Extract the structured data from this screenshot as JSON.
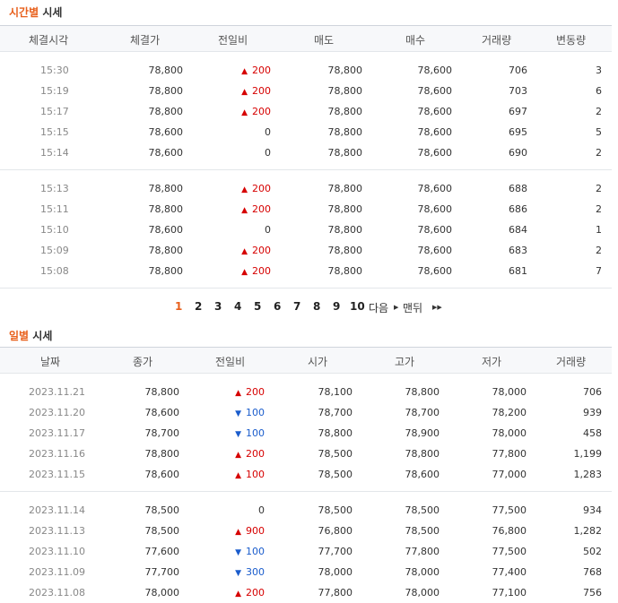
{
  "time_section": {
    "title_highlight": "시간별",
    "title_rest": "시세",
    "headers": [
      "체결시각",
      "체결가",
      "전일비",
      "매도",
      "매수",
      "거래량",
      "변동량"
    ],
    "groups": [
      [
        {
          "time": "15:30",
          "price": "78,800",
          "diff": "200",
          "dir": "up",
          "ask": "78,800",
          "bid": "78,600",
          "volume": "706",
          "change": "3"
        },
        {
          "time": "15:19",
          "price": "78,800",
          "diff": "200",
          "dir": "up",
          "ask": "78,800",
          "bid": "78,600",
          "volume": "703",
          "change": "6"
        },
        {
          "time": "15:17",
          "price": "78,800",
          "diff": "200",
          "dir": "up",
          "ask": "78,800",
          "bid": "78,600",
          "volume": "697",
          "change": "2"
        },
        {
          "time": "15:15",
          "price": "78,600",
          "diff": "0",
          "dir": "none",
          "ask": "78,800",
          "bid": "78,600",
          "volume": "695",
          "change": "5"
        },
        {
          "time": "15:14",
          "price": "78,600",
          "diff": "0",
          "dir": "none",
          "ask": "78,800",
          "bid": "78,600",
          "volume": "690",
          "change": "2"
        }
      ],
      [
        {
          "time": "15:13",
          "price": "78,800",
          "diff": "200",
          "dir": "up",
          "ask": "78,800",
          "bid": "78,600",
          "volume": "688",
          "change": "2"
        },
        {
          "time": "15:11",
          "price": "78,800",
          "diff": "200",
          "dir": "up",
          "ask": "78,800",
          "bid": "78,600",
          "volume": "686",
          "change": "2"
        },
        {
          "time": "15:10",
          "price": "78,600",
          "diff": "0",
          "dir": "none",
          "ask": "78,800",
          "bid": "78,600",
          "volume": "684",
          "change": "1"
        },
        {
          "time": "15:09",
          "price": "78,800",
          "diff": "200",
          "dir": "up",
          "ask": "78,800",
          "bid": "78,600",
          "volume": "683",
          "change": "2"
        },
        {
          "time": "15:08",
          "price": "78,800",
          "diff": "200",
          "dir": "up",
          "ask": "78,800",
          "bid": "78,600",
          "volume": "681",
          "change": "7"
        }
      ]
    ]
  },
  "pagination": {
    "pages": [
      "1",
      "2",
      "3",
      "4",
      "5",
      "6",
      "7",
      "8",
      "9",
      "10"
    ],
    "current": "1",
    "next_label": "다음",
    "last_label": "맨뒤"
  },
  "daily_section": {
    "title_highlight": "일별",
    "title_rest": "시세",
    "headers": [
      "날짜",
      "종가",
      "전일비",
      "시가",
      "고가",
      "저가",
      "거래량"
    ],
    "groups": [
      [
        {
          "date": "2023.11.21",
          "close": "78,800",
          "diff": "200",
          "dir": "up",
          "open": "78,100",
          "high": "78,800",
          "low": "78,000",
          "volume": "706"
        },
        {
          "date": "2023.11.20",
          "close": "78,600",
          "diff": "100",
          "dir": "down",
          "open": "78,700",
          "high": "78,700",
          "low": "78,200",
          "volume": "939"
        },
        {
          "date": "2023.11.17",
          "close": "78,700",
          "diff": "100",
          "dir": "down",
          "open": "78,800",
          "high": "78,900",
          "low": "78,000",
          "volume": "458"
        },
        {
          "date": "2023.11.16",
          "close": "78,800",
          "diff": "200",
          "dir": "up",
          "open": "78,500",
          "high": "78,800",
          "low": "77,800",
          "volume": "1,199"
        },
        {
          "date": "2023.11.15",
          "close": "78,600",
          "diff": "100",
          "dir": "up",
          "open": "78,500",
          "high": "78,600",
          "low": "77,000",
          "volume": "1,283"
        }
      ],
      [
        {
          "date": "2023.11.14",
          "close": "78,500",
          "diff": "0",
          "dir": "none",
          "open": "78,500",
          "high": "78,500",
          "low": "77,500",
          "volume": "934"
        },
        {
          "date": "2023.11.13",
          "close": "78,500",
          "diff": "900",
          "dir": "up",
          "open": "76,800",
          "high": "78,500",
          "low": "76,800",
          "volume": "1,282"
        },
        {
          "date": "2023.11.10",
          "close": "77,600",
          "diff": "100",
          "dir": "down",
          "open": "77,700",
          "high": "77,800",
          "low": "77,500",
          "volume": "502"
        },
        {
          "date": "2023.11.09",
          "close": "77,700",
          "diff": "300",
          "dir": "down",
          "open": "78,000",
          "high": "78,000",
          "low": "77,400",
          "volume": "768"
        },
        {
          "date": "2023.11.08",
          "close": "78,000",
          "diff": "200",
          "dir": "up",
          "open": "77,800",
          "high": "78,000",
          "low": "77,100",
          "volume": "756"
        }
      ]
    ]
  },
  "colors": {
    "accent": "#e8601c",
    "up": "#d60000",
    "down": "#1a5ccc"
  }
}
